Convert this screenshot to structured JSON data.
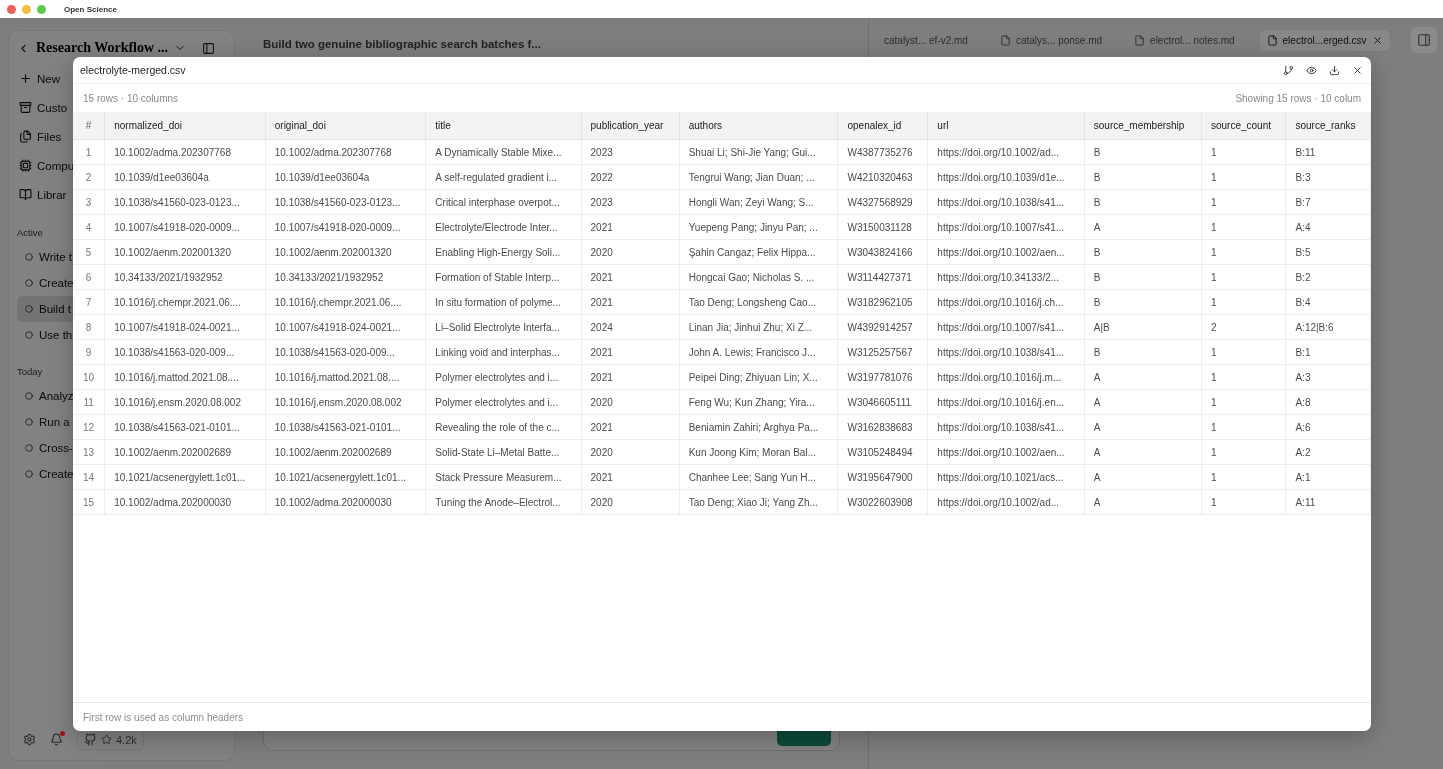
{
  "window": {
    "title": "Open Science"
  },
  "sidebar": {
    "project": "Research Workflow ...",
    "nav": [
      {
        "label": "New",
        "kind": "new"
      },
      {
        "label": "Custo",
        "kind": "custom"
      },
      {
        "label": "Files",
        "kind": "files"
      },
      {
        "label": "Compu",
        "kind": "compute"
      },
      {
        "label": "Librar",
        "kind": "library"
      }
    ],
    "sections": [
      {
        "heading": "Active",
        "items": [
          {
            "label": "Write t",
            "selected": false
          },
          {
            "label": "Create",
            "selected": false
          },
          {
            "label": "Build t",
            "selected": true
          },
          {
            "label": "Use th",
            "selected": false
          }
        ]
      },
      {
        "heading": "Today",
        "items": [
          {
            "label": "Analyz",
            "selected": false
          },
          {
            "label": "Run a",
            "selected": false
          },
          {
            "label": "Cross-",
            "selected": false
          },
          {
            "label": "Create",
            "selected": false
          }
        ]
      }
    ],
    "github_stars": "4.2k",
    "notification": true
  },
  "chat": {
    "title": "Build two genuine bibliographic search batches f..."
  },
  "file_tabs": [
    {
      "label": "catalyst... ef-v2.md",
      "selected": false,
      "icon": false
    },
    {
      "label": "catalys... ponse.md",
      "selected": false,
      "icon": true
    },
    {
      "label": "electrol... notes.md",
      "selected": false,
      "icon": true
    },
    {
      "label": "electrol...erged.csv",
      "selected": true,
      "icon": true
    }
  ],
  "preview": {
    "title": "electrolyte-merged.csv",
    "summary": "15 rows · 10 columns",
    "showing": "Showing 15 rows · 10 colum",
    "columns": [
      "#",
      "normalized_doi",
      "original_doi",
      "title",
      "publication_year",
      "authors",
      "openalex_id",
      "url",
      "source_membership",
      "source_count",
      "source_ranks"
    ],
    "rows": [
      [
        "1",
        "10.1002/adma.202307768",
        "10.1002/adma.202307768",
        "A Dynamically Stable Mixe...",
        "2023",
        "Shuai Li; Shi-Jie Yang; Gui...",
        "W4387735276",
        "https://doi.org/10.1002/ad...",
        "B",
        "1",
        "B:11"
      ],
      [
        "2",
        "10.1039/d1ee03604a",
        "10.1039/d1ee03604a",
        "A self-regulated gradient i...",
        "2022",
        "Tengrui Wang; Jian Duan; ...",
        "W4210320463",
        "https://doi.org/10.1039/d1e...",
        "B",
        "1",
        "B:3"
      ],
      [
        "3",
        "10.1038/s41560-023-0123...",
        "10.1038/s41560-023-0123...",
        "Critical interphase overpot...",
        "2023",
        "Hongli Wan; Zeyi Wang; S...",
        "W4327568929",
        "https://doi.org/10.1038/s41...",
        "B",
        "1",
        "B:7"
      ],
      [
        "4",
        "10.1007/s41918-020-0009...",
        "10.1007/s41918-020-0009...",
        "Electrolyte/Electrode Inter...",
        "2021",
        "Yuepeng Pang; Jinyu Pan; ...",
        "W3150031128",
        "https://doi.org/10.1007/s41...",
        "A",
        "1",
        "A:4"
      ],
      [
        "5",
        "10.1002/aenm.202001320",
        "10.1002/aenm.202001320",
        "Enabling High-Energy Soli...",
        "2020",
        "Şahin Cangaz; Felix Hippa...",
        "W3043824166",
        "https://doi.org/10.1002/aen...",
        "B",
        "1",
        "B:5"
      ],
      [
        "6",
        "10.34133/2021/1932952",
        "10.34133/2021/1932952",
        "Formation of Stable Interp...",
        "2021",
        "Hongcai Gao; Nicholas S. ...",
        "W3114427371",
        "https://doi.org/10.34133/2...",
        "B",
        "1",
        "B:2"
      ],
      [
        "7",
        "10.1016/j.chempr.2021.06....",
        "10.1016/j.chempr.2021.06....",
        "In situ formation of polyme...",
        "2021",
        "Tao Deng; Longsheng Cao...",
        "W3182962105",
        "https://doi.org/10.1016/j.ch...",
        "B",
        "1",
        "B:4"
      ],
      [
        "8",
        "10.1007/s41918-024-0021...",
        "10.1007/s41918-024-0021...",
        "Li–Solid Electrolyte Interfa...",
        "2024",
        "Linan Jia; Jinhui Zhu; Xi Z...",
        "W4392914257",
        "https://doi.org/10.1007/s41...",
        "A|B",
        "2",
        "A:12|B:6"
      ],
      [
        "9",
        "10.1038/s41563-020-009...",
        "10.1038/s41563-020-009...",
        "Linking void and interphas...",
        "2021",
        "John A. Lewis; Francisco J...",
        "W3125257567",
        "https://doi.org/10.1038/s41...",
        "B",
        "1",
        "B:1"
      ],
      [
        "10",
        "10.1016/j.mattod.2021.08....",
        "10.1016/j.mattod.2021.08....",
        "Polymer electrolytes and i...",
        "2021",
        "Peipei Ding; Zhiyuan Lin; X...",
        "W3197781076",
        "https://doi.org/10.1016/j.m...",
        "A",
        "1",
        "A:3"
      ],
      [
        "11",
        "10.1016/j.ensm.2020.08.002",
        "10.1016/j.ensm.2020.08.002",
        "Polymer electrolytes and i...",
        "2020",
        "Feng Wu; Kun Zhang; Yira...",
        "W3046605111",
        "https://doi.org/10.1016/j.en...",
        "A",
        "1",
        "A:8"
      ],
      [
        "12",
        "10.1038/s41563-021-0101...",
        "10.1038/s41563-021-0101...",
        "Revealing the role of the c...",
        "2021",
        "Beniamin Zahiri; Arghya Pa...",
        "W3162838683",
        "https://doi.org/10.1038/s41...",
        "A",
        "1",
        "A:6"
      ],
      [
        "13",
        "10.1002/aenm.202002689",
        "10.1002/aenm.202002689",
        "Solid-State Li–Metal Batte...",
        "2020",
        "Kun Joong Kim; Moran Bal...",
        "W3105248494",
        "https://doi.org/10.1002/aen...",
        "A",
        "1",
        "A:2"
      ],
      [
        "14",
        "10.1021/acsenergylett.1c01...",
        "10.1021/acsenergylett.1c01...",
        "Stack Pressure Measurem...",
        "2021",
        "Chanhee Lee; Sang Yun H...",
        "W3195647900",
        "https://doi.org/10.1021/acs...",
        "A",
        "1",
        "A:1"
      ],
      [
        "15",
        "10.1002/adma.202000030",
        "10.1002/adma.202000030",
        "Tuning the Anode–Electrol...",
        "2020",
        "Tao Deng; Xiao Ji; Yang Zh...",
        "W3022603908",
        "https://doi.org/10.1002/ad...",
        "A",
        "1",
        "A:11"
      ]
    ],
    "footer": "First row is used as column headers"
  }
}
